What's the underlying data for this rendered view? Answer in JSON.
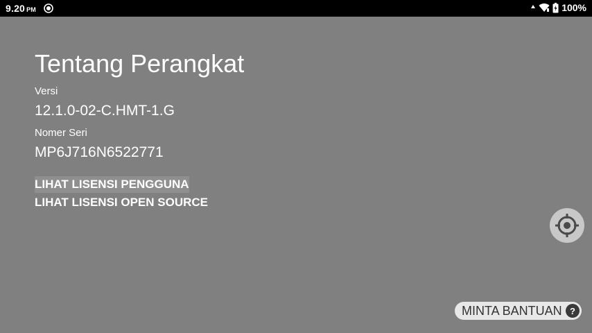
{
  "status_bar": {
    "time": "9.20",
    "ampm": "PM",
    "battery": "100%",
    "icons": [
      "notification-icon",
      "signal-icon",
      "wifi-icon",
      "battery-charging-icon"
    ]
  },
  "page": {
    "title": "Tentang Perangkat",
    "version_label": "Versi",
    "version_value": "12.1.0-02-C.HMT-1.G",
    "serial_label": "Nomer Seri",
    "serial_value": "MP6J716N6522771",
    "link_user_license": "LIHAT LISENSI PENGGUNA",
    "link_open_source": "LIHAT LISENSI OPEN SOURCE"
  },
  "floating": {
    "target_icon": "crosshair-icon",
    "help_label": "MINTA BANTUAN",
    "help_icon": "question-icon",
    "help_glyph": "?"
  },
  "colors": {
    "background": "#808080",
    "status_bar": "#000000",
    "text": "#ffffff",
    "fab": "#c8c8c8",
    "help_pill": "#e8e8e8"
  }
}
